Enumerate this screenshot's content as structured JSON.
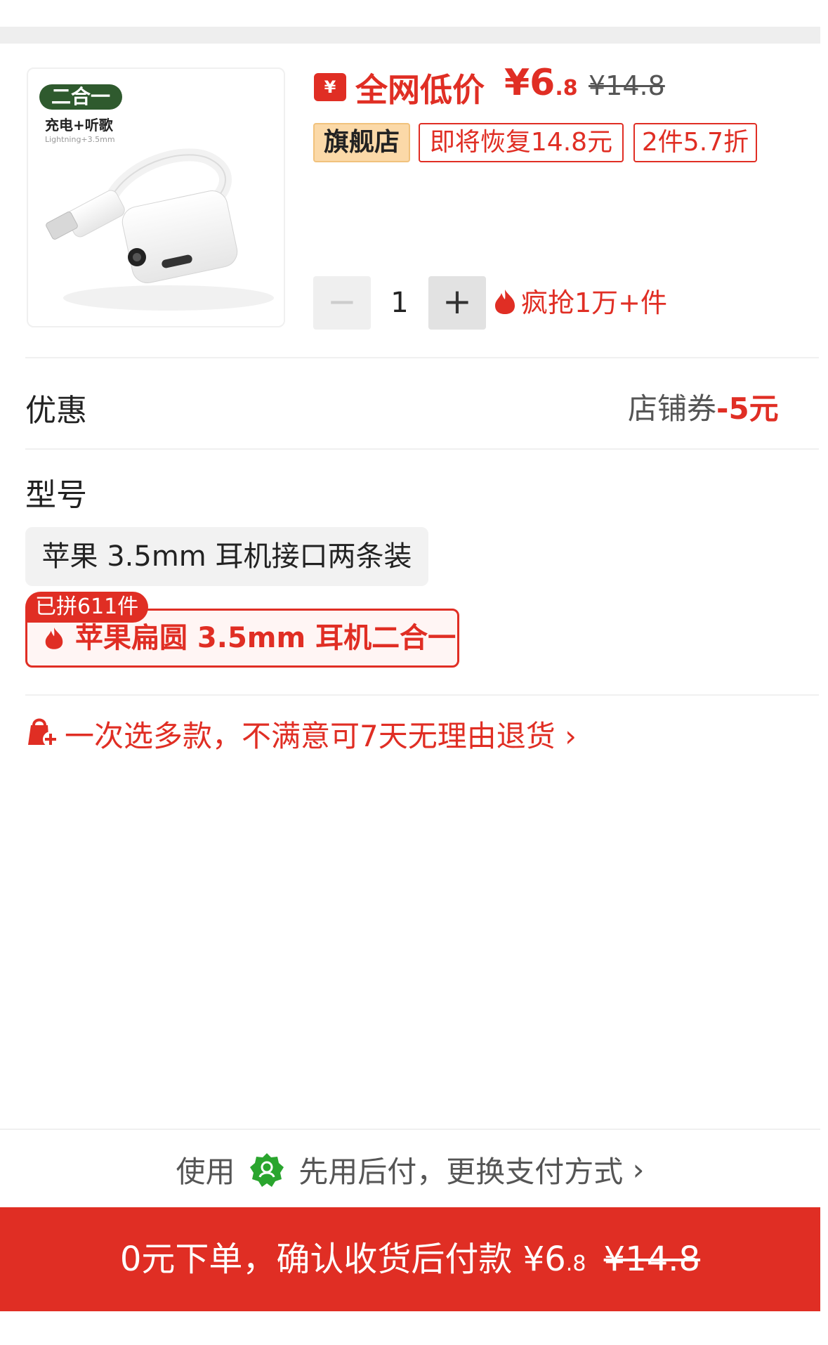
{
  "product": {
    "image_badge": "二合一",
    "image_caption": "充电+听歌",
    "image_sub": "Lightning+3.5mm",
    "price_icon": "¥",
    "price_label": "全网低价",
    "price_main": "¥6",
    "price_cents": ".8",
    "price_original": "¥14.8",
    "tags": {
      "flagship": "旗舰店",
      "restore": "即将恢复14.8元",
      "multi": "2件5.7折"
    },
    "quantity": {
      "minus": "−",
      "value": "1",
      "plus": "+"
    },
    "hot_sale": "疯抢1万+件"
  },
  "discount": {
    "title": "优惠",
    "coupon_label": "店铺券",
    "coupon_amount": "-5元"
  },
  "model": {
    "title": "型号",
    "options": [
      {
        "label": "苹果 3.5mm 耳机接口两条装"
      },
      {
        "label": "苹果扁圆 3.5mm 耳机二合一",
        "badge": "已拼611件"
      }
    ]
  },
  "promise": {
    "text": "一次选多款，不满意可7天无理由退货",
    "arrow": "›"
  },
  "payment": {
    "prefix": "使用",
    "method": "先用后付，更换支付方式",
    "arrow": "›"
  },
  "order_button": {
    "label": "0元下单，确认收货后付款",
    "price_main": "¥6",
    "price_cents": ".8",
    "price_original": "¥14.8"
  },
  "colors": {
    "accent": "#e02e24",
    "flagship_bg": "#fbd9a8",
    "pay_icon": "#2aa52e"
  }
}
